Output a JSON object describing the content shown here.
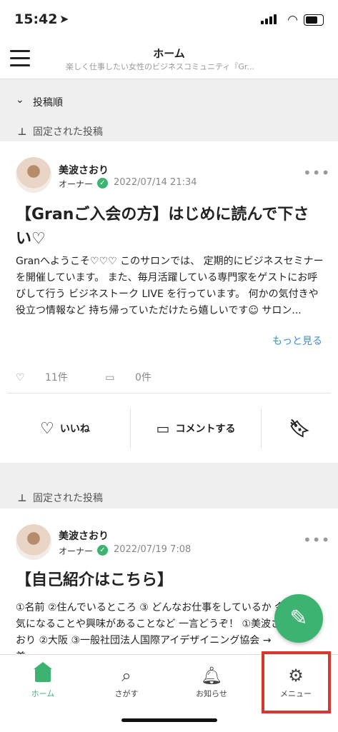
{
  "status": {
    "time": "15:42",
    "location_icon": "location-arrow-icon"
  },
  "header": {
    "title": "ホーム",
    "subtitle": "楽しく仕事したい女性のビジネスコミュニティ『Gr..."
  },
  "sort": {
    "label": "投稿順"
  },
  "posts": [
    {
      "pinned_label": "固定された投稿",
      "author": "美波さおり",
      "role": "オーナー",
      "date": "2022/07/14 21:34",
      "title": "【Granご入会の方】はじめに読んで下さい♡",
      "body": "Granへようこそ♡♡♡ このサロンでは、 定期的にビジネスセミナーを開催しています。 また、毎月活躍している専門家をゲストにお呼びして行う ビジネストーク LIVE を行っています。 何かの気付きや役立つ情報など 持ち帰っていただけたら嬉しいです☺ サロン...",
      "more_link": "もっと見る",
      "likes": "11件",
      "comments": "0件",
      "like_label": "いいね",
      "comment_label": "コメントする"
    },
    {
      "pinned_label": "固定された投稿",
      "author": "美波さおり",
      "role": "オーナー",
      "date": "2022/07/19 7:08",
      "title": "【自己紹介はこちら】",
      "body": "①名前 ②住んでいるところ ③ どんなお仕事をしているか 今気になることや興味があることなど 一言どうぞ！ ①美波さおり ②大阪 ③一般社団法人国際アイデザイニング協会 → 美..."
    }
  ],
  "tabs": [
    {
      "label": "ホーム",
      "icon": "home-icon",
      "active": true
    },
    {
      "label": "さがす",
      "icon": "search-icon"
    },
    {
      "label": "お知らせ",
      "icon": "bell-icon"
    },
    {
      "label": "メニュー",
      "icon": "gear-icon"
    }
  ],
  "colors": {
    "accent": "#3cb371",
    "link": "#3b8fd9",
    "highlight": "#d6382f"
  }
}
